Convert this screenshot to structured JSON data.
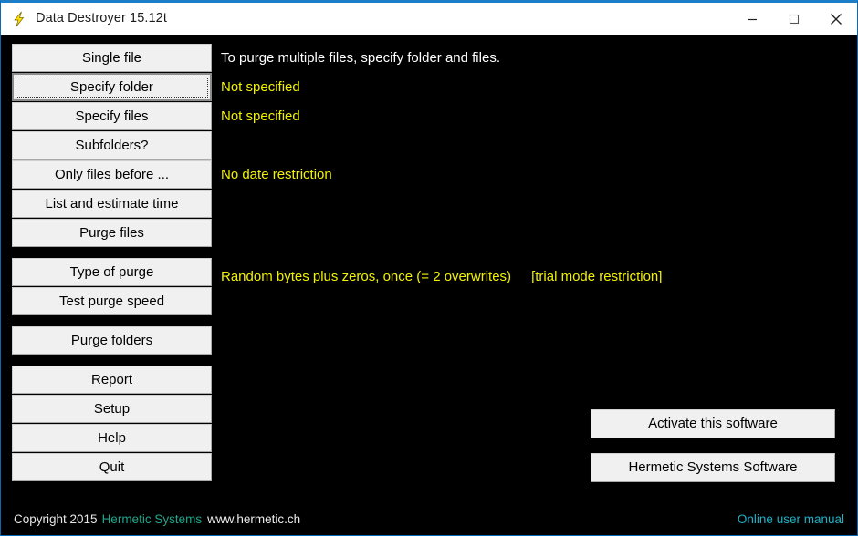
{
  "window": {
    "title": "Data Destroyer 15.12t",
    "icon": "lightning-bolt-icon",
    "accent_border_color": "#1b7ec6",
    "client_background": "#000000",
    "controls": {
      "minimize": "minimize-icon",
      "maximize": "maximize-icon",
      "close": "close-icon"
    }
  },
  "colors": {
    "status_yellow": "#f2f200",
    "status_white": "#ffffff",
    "link_teal": "#21a68c",
    "link_cyan": "#1fb0c8",
    "button_face": "#f0f0f0"
  },
  "button_groups": [
    {
      "buttons": [
        {
          "label": "Single file",
          "focused": false
        },
        {
          "label": "Specify folder",
          "focused": true
        },
        {
          "label": "Specify files",
          "focused": false
        },
        {
          "label": "Subfolders?",
          "focused": false
        },
        {
          "label": "Only files before ...",
          "focused": false
        },
        {
          "label": "List and estimate time",
          "focused": false
        },
        {
          "label": "Purge files",
          "focused": false
        }
      ]
    },
    {
      "buttons": [
        {
          "label": "Type of purge",
          "focused": false
        },
        {
          "label": "Test purge speed",
          "focused": false
        }
      ]
    },
    {
      "buttons": [
        {
          "label": "Purge folders",
          "focused": false
        }
      ]
    },
    {
      "buttons": [
        {
          "label": "Report",
          "focused": false
        },
        {
          "label": "Setup",
          "focused": false
        },
        {
          "label": "Help",
          "focused": false
        },
        {
          "label": "Quit",
          "focused": false
        }
      ]
    }
  ],
  "status_lines": [
    {
      "text": "To purge multiple files, specify folder and files.",
      "style": "white"
    },
    {
      "text": "Not specified",
      "style": "yellow"
    },
    {
      "text": "Not specified",
      "style": "yellow"
    },
    {
      "text": "",
      "style": "blank"
    },
    {
      "text": "No date restriction",
      "style": "yellow"
    },
    {
      "text": "",
      "style": "blank"
    },
    {
      "text": "",
      "style": "blank"
    }
  ],
  "purge_type": {
    "description": "Random bytes plus zeros, once (= 2 overwrites)",
    "note": "[trial mode restriction]"
  },
  "right_buttons": {
    "activate": "Activate this software",
    "vendor": "Hermetic Systems Software"
  },
  "footer": {
    "copyright": "Copyright 2015",
    "company": "Hermetic Systems",
    "url": "www.hermetic.ch",
    "manual_link": "Online user manual"
  }
}
